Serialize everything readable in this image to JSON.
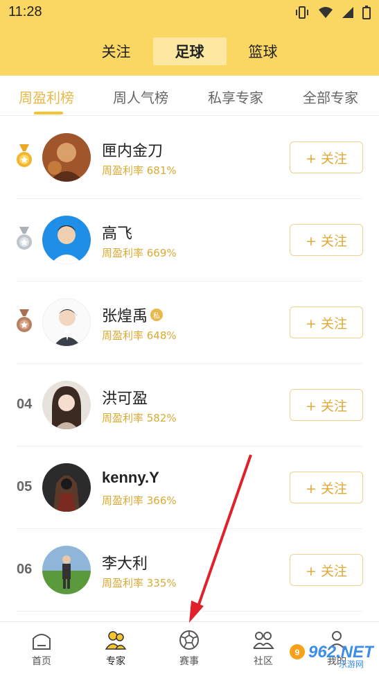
{
  "status_bar": {
    "time": "11:28"
  },
  "top_tabs": [
    {
      "label": "关注",
      "active": false
    },
    {
      "label": "足球",
      "active": true
    },
    {
      "label": "篮球",
      "active": false
    }
  ],
  "sub_tabs": [
    {
      "label": "周盈利榜",
      "active": true
    },
    {
      "label": "周人气榜",
      "active": false
    },
    {
      "label": "私享专家",
      "active": false
    },
    {
      "label": "全部专家",
      "active": false
    }
  ],
  "experts": [
    {
      "rank": "1",
      "medal": "gold",
      "name": "匣内金刀",
      "rate": "周盈利率 681%",
      "private": false,
      "follow": "+ 关注"
    },
    {
      "rank": "2",
      "medal": "silver",
      "name": "高飞",
      "rate": "周盈利率 669%",
      "private": false,
      "follow": "+ 关注"
    },
    {
      "rank": "3",
      "medal": "bronze",
      "name": "张煌禹",
      "rate": "周盈利率 648%",
      "private": true,
      "private_label": "私",
      "follow": "+ 关注"
    },
    {
      "rank": "04",
      "medal": "",
      "name": "洪可盈",
      "rate": "周盈利率 582%",
      "private": false,
      "follow": "+ 关注"
    },
    {
      "rank": "05",
      "medal": "",
      "name": "kenny.Y",
      "rate": "周盈利率 366%",
      "private": false,
      "follow": "+ 关注"
    },
    {
      "rank": "06",
      "medal": "",
      "name": "李大利",
      "rate": "周盈利率 335%",
      "private": false,
      "follow": "+ 关注"
    }
  ],
  "bottom_nav": [
    {
      "label": "首页",
      "icon": "home-icon",
      "active": false
    },
    {
      "label": "专家",
      "icon": "experts-icon",
      "active": true
    },
    {
      "label": "赛事",
      "icon": "football-icon",
      "active": false
    },
    {
      "label": "社区",
      "icon": "community-icon",
      "active": false
    },
    {
      "label": "我的",
      "icon": "profile-icon",
      "active": false
    }
  ],
  "watermark": {
    "text": "962.NET",
    "subtext": "乐游网"
  },
  "colors": {
    "brand_yellow": "#fad763",
    "accent_gold": "#e8b94a",
    "annotation_red": "#e0202a"
  }
}
